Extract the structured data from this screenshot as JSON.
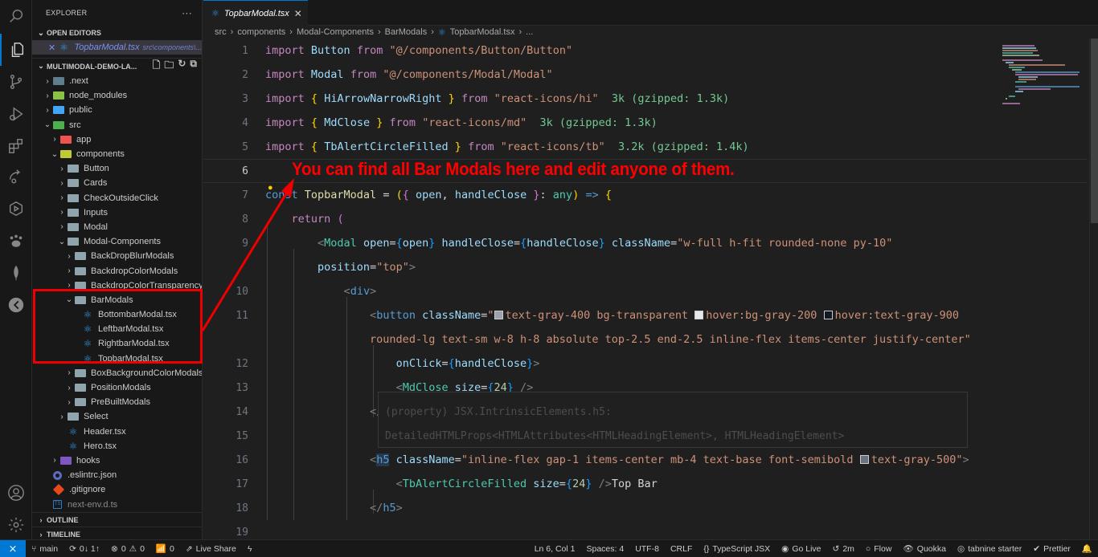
{
  "explorer": {
    "title": "EXPLORER",
    "more": "···",
    "open_editors_label": "OPEN EDITORS",
    "open_editor": {
      "name": "TopbarModal.tsx",
      "path": "src\\components\\..."
    },
    "project_label": "MULTIMODAL-DEMO-LA...",
    "tree": [
      {
        "label": ".next",
        "depth": 0,
        "chev": "›",
        "icon": "folder-next",
        "color": "#607d8b"
      },
      {
        "label": "node_modules",
        "depth": 0,
        "chev": "›",
        "icon": "folder-node",
        "color": "#8bc34a"
      },
      {
        "label": "public",
        "depth": 0,
        "chev": "›",
        "icon": "folder-public",
        "color": "#42a5f5"
      },
      {
        "label": "src",
        "depth": 0,
        "chev": "⌄",
        "icon": "folder-src",
        "color": "#4caf50"
      },
      {
        "label": "app",
        "depth": 1,
        "chev": "›",
        "icon": "folder-app",
        "color": "#ef5350"
      },
      {
        "label": "components",
        "depth": 1,
        "chev": "⌄",
        "icon": "folder-components",
        "color": "#c0ca33"
      },
      {
        "label": "Button",
        "depth": 2,
        "chev": "›",
        "icon": "folder",
        "color": "#90a4ae"
      },
      {
        "label": "Cards",
        "depth": 2,
        "chev": "›",
        "icon": "folder",
        "color": "#90a4ae"
      },
      {
        "label": "CheckOutsideClick",
        "depth": 2,
        "chev": "›",
        "icon": "folder",
        "color": "#90a4ae"
      },
      {
        "label": "Inputs",
        "depth": 2,
        "chev": "›",
        "icon": "folder",
        "color": "#90a4ae"
      },
      {
        "label": "Modal",
        "depth": 2,
        "chev": "›",
        "icon": "folder",
        "color": "#90a4ae"
      },
      {
        "label": "Modal-Components",
        "depth": 2,
        "chev": "⌄",
        "icon": "folder-open",
        "color": "#90a4ae"
      },
      {
        "label": "BackDropBlurModals",
        "depth": 3,
        "chev": "›",
        "icon": "folder",
        "color": "#90a4ae"
      },
      {
        "label": "BackdropColorModals",
        "depth": 3,
        "chev": "›",
        "icon": "folder",
        "color": "#90a4ae"
      },
      {
        "label": "BackdropColorTransparency...",
        "depth": 3,
        "chev": "›",
        "icon": "folder",
        "color": "#90a4ae"
      },
      {
        "label": "BarModals",
        "depth": 3,
        "chev": "⌄",
        "icon": "folder-open",
        "color": "#90a4ae"
      },
      {
        "label": "BottombarModal.tsx",
        "depth": 4,
        "chev": "",
        "icon": "react",
        "color": "#2f98e6"
      },
      {
        "label": "LeftbarModal.tsx",
        "depth": 4,
        "chev": "",
        "icon": "react",
        "color": "#2f98e6"
      },
      {
        "label": "RightbarModal.tsx",
        "depth": 4,
        "chev": "",
        "icon": "react",
        "color": "#2f98e6"
      },
      {
        "label": "TopbarModal.tsx",
        "depth": 4,
        "chev": "",
        "icon": "react",
        "color": "#2f98e6"
      },
      {
        "label": "BoxBackgroundColorModals",
        "depth": 3,
        "chev": "›",
        "icon": "folder",
        "color": "#90a4ae"
      },
      {
        "label": "PositionModals",
        "depth": 3,
        "chev": "›",
        "icon": "folder",
        "color": "#90a4ae"
      },
      {
        "label": "PreBuiltModals",
        "depth": 3,
        "chev": "›",
        "icon": "folder",
        "color": "#90a4ae"
      },
      {
        "label": "Select",
        "depth": 2,
        "chev": "›",
        "icon": "folder",
        "color": "#90a4ae"
      },
      {
        "label": "Header.tsx",
        "depth": 2,
        "chev": "",
        "icon": "react",
        "color": "#2f98e6"
      },
      {
        "label": "Hero.tsx",
        "depth": 2,
        "chev": "",
        "icon": "react",
        "color": "#2f98e6"
      },
      {
        "label": "hooks",
        "depth": 1,
        "chev": "›",
        "icon": "folder-hooks",
        "color": "#7e57c2"
      },
      {
        "label": ".eslintrc.json",
        "depth": 0,
        "chev": "",
        "icon": "eslint",
        "color": "#5c6bc0"
      },
      {
        "label": ".gitignore",
        "depth": 0,
        "chev": "",
        "icon": "git",
        "color": "#e64a19"
      },
      {
        "label": "next-env.d.ts",
        "depth": 0,
        "chev": "",
        "icon": "ts",
        "color": "#3178c6",
        "dim": true
      }
    ],
    "outline_label": "OUTLINE",
    "timeline_label": "TIMELINE"
  },
  "tab": {
    "label": "TopbarModal.tsx",
    "close": "✕"
  },
  "breadcrumb": [
    "src",
    "components",
    "Modal-Components",
    "BarModals",
    "TopbarModal.tsx",
    "..."
  ],
  "annotation": "You can find all Bar Modals here and edit anyone of them.",
  "code": {
    "line_numbers": [
      "1",
      "2",
      "3",
      "4",
      "5",
      "6",
      "7",
      "8",
      "9",
      "",
      "10",
      "11",
      "",
      "12",
      "13",
      "14",
      "15",
      "16",
      "17",
      "18",
      "19"
    ],
    "current_line": "6",
    "hover_text": [
      "(property) JSX.IntrinsicElements.h5:",
      "DetailedHTMLProps<HTMLAttributes<HTMLHeadingElement>, HTMLHeadingElement>"
    ]
  },
  "statusbar": {
    "remote": "⨯",
    "branch": "main",
    "sync": "0↓ 1↑",
    "errors": "0",
    "warnings": "0",
    "ports": "0",
    "liveshare": "Live Share",
    "position": "Ln 6, Col 1",
    "spaces": "Spaces: 4",
    "encoding": "UTF-8",
    "eol": "CRLF",
    "language": "TypeScript JSX",
    "golive": "Go Live",
    "timer": "2m",
    "flow": "Flow",
    "quokka": "Quokka",
    "tabnine": "tabnine starter",
    "prettier": "Prettier"
  }
}
